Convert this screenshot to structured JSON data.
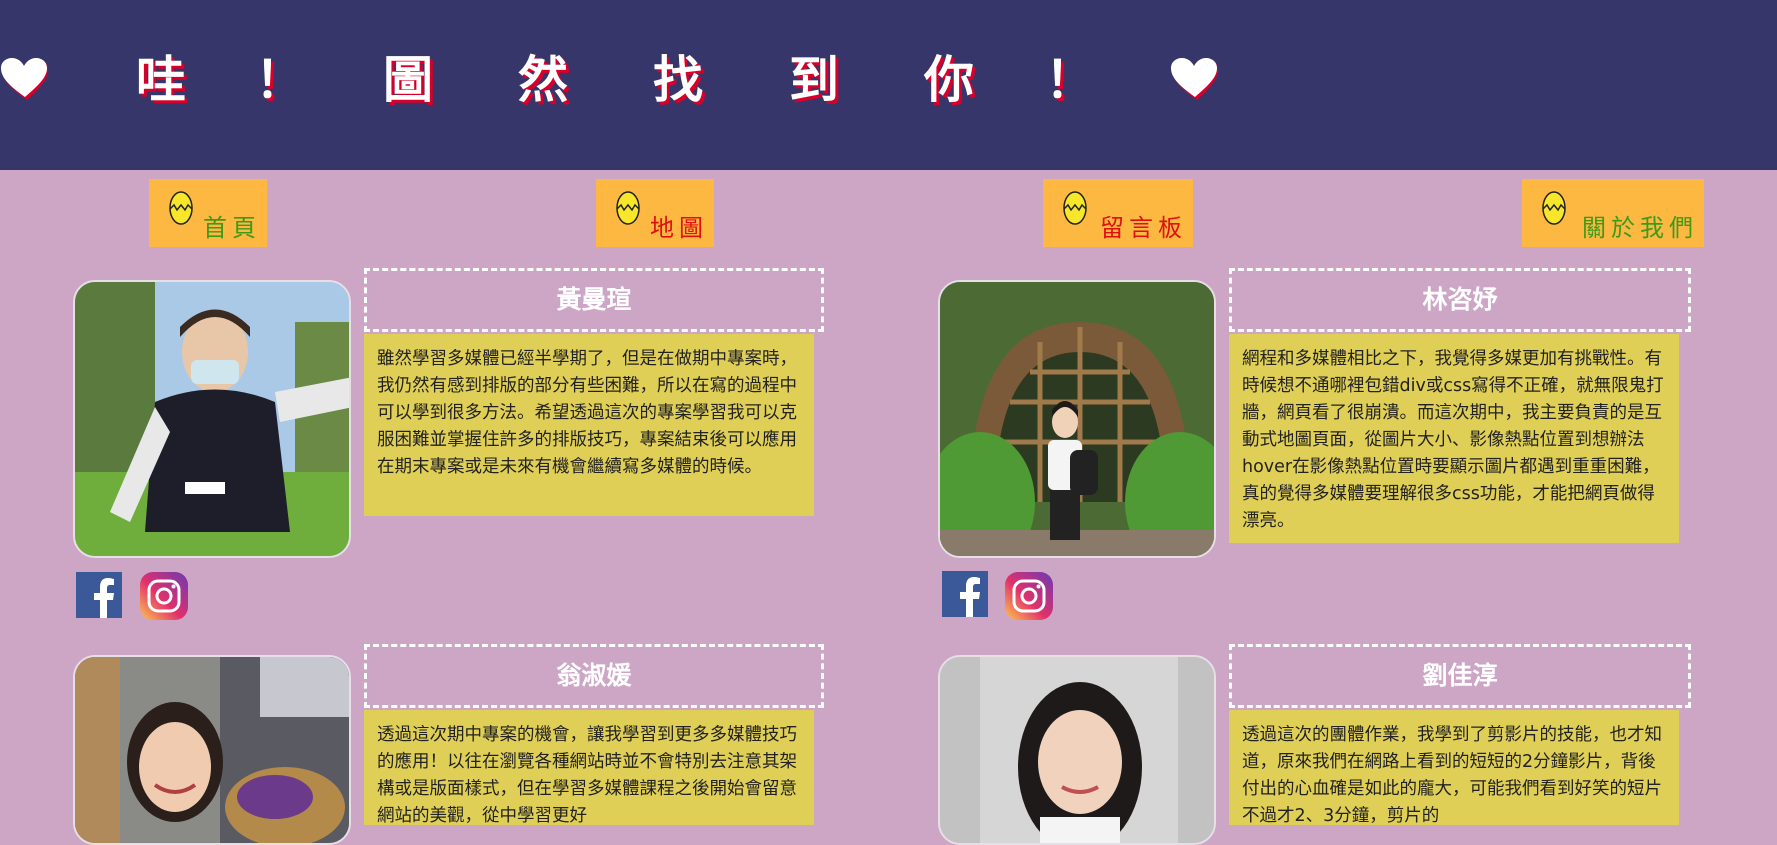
{
  "header": {
    "title_chars": [
      "哇",
      "！",
      "圖",
      "然",
      "找",
      "到",
      "你",
      "！"
    ],
    "left_icon": "heart-icon",
    "right_icon": "heart-icon",
    "background_color": "#36366a",
    "text_color": "#ffffff",
    "shadow_color": "#d8002a"
  },
  "nav": {
    "icon": "egg-icon",
    "button_color": "#fdb842",
    "items": [
      {
        "label": "首頁",
        "color": "#3f9a1a"
      },
      {
        "label": "地圖",
        "color": "#e01010"
      },
      {
        "label": "留言板",
        "color": "#e01010"
      },
      {
        "label": "關於我們",
        "color": "#3f9a1a"
      }
    ]
  },
  "members": [
    {
      "name": "黃曼瑄",
      "description": "雖然學習多媒體已經半學期了，但是在做期中專案時，我仍然有感到排版的部分有些困難，所以在寫的過程中可以學到很多方法。希望透過這次的專案學習我可以克服困難並掌握住許多的排版技巧，專案結束後可以應用在期末專案或是未來有機會繼續寫多媒體的時候。",
      "photo_icon": "member-photo",
      "social": [
        "facebook-icon",
        "instagram-icon"
      ]
    },
    {
      "name": "林咨妤",
      "description": "網程和多媒體相比之下，我覺得多媒更加有挑戰性。有時候想不通哪裡包錯div或css寫得不正確，就無限鬼打牆，網頁看了很崩潰。而這次期中，我主要負責的是互動式地圖頁面，從圖片大小、影像熱點位置到想辦法hover在影像熱點位置時要顯示圖片都遇到重重困難，真的覺得多媒體要理解很多css功能，才能把網頁做得漂亮。",
      "photo_icon": "member-photo",
      "social": [
        "facebook-icon",
        "instagram-icon"
      ]
    },
    {
      "name": "翁淑媛",
      "description": "透過這次期中專案的機會，讓我學習到更多多媒體技巧的應用！以往在瀏覽各種網站時並不會特別去注意其架構或是版面樣式，但在學習多媒體課程之後開始會留意網站的美觀，從中學習更好",
      "photo_icon": "member-photo",
      "social": []
    },
    {
      "name": "劉佳淳",
      "description": "透過這次的團體作業，我學到了剪影片的技能，也才知道，原來我們在網路上看到的短短的2分鐘影片，背後付出的心血確是如此的龐大，可能我們看到好笑的短片不過才2、3分鐘，剪片的",
      "photo_icon": "member-photo",
      "social": []
    }
  ]
}
